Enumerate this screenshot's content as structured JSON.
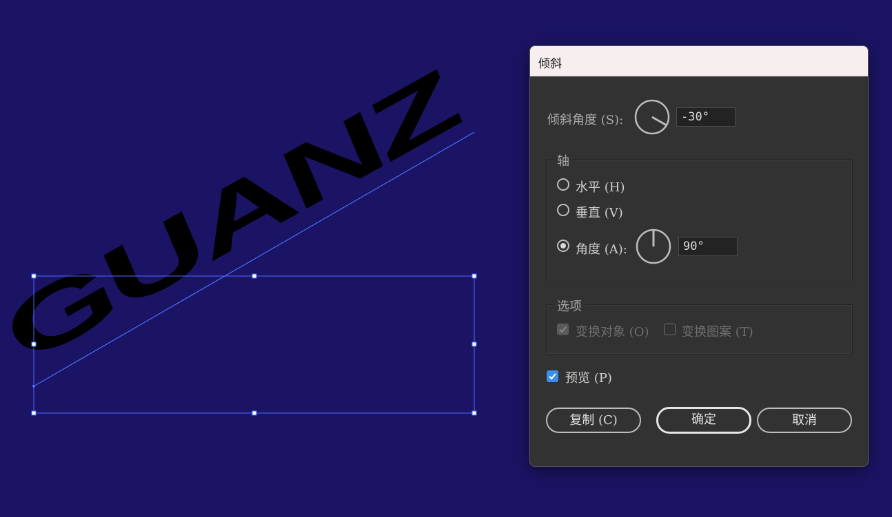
{
  "artwork": {
    "text": "GUANZ",
    "fill_color": "#000000",
    "background_color": "#1b1464",
    "selection_color": "#4a6cff"
  },
  "dialog": {
    "title": "倾斜",
    "shear_angle": {
      "label": "倾斜角度 (S):",
      "value": "-30°"
    },
    "axis": {
      "legend": "轴",
      "horizontal_label": "水平 (H)",
      "vertical_label": "垂直 (V)",
      "angle_label": "角度 (A):",
      "angle_value": "90°",
      "selected": "angle"
    },
    "options": {
      "legend": "选项",
      "transform_objects_label": "变换对象 (O)",
      "transform_objects_checked": true,
      "transform_patterns_label": "变换图案 (T)",
      "transform_patterns_checked": false
    },
    "preview": {
      "label": "预览 (P)",
      "checked": true
    },
    "buttons": {
      "copy": "复制 (C)",
      "ok": "确定",
      "cancel": "取消"
    }
  }
}
